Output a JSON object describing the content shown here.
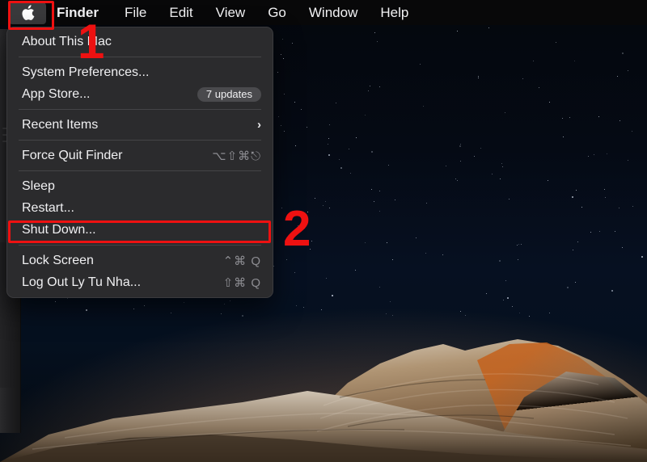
{
  "menubar": {
    "apple_icon": "apple-logo-icon",
    "items": [
      {
        "label": "Finder",
        "bold": true
      },
      {
        "label": "File",
        "bold": false
      },
      {
        "label": "Edit",
        "bold": false
      },
      {
        "label": "View",
        "bold": false
      },
      {
        "label": "Go",
        "bold": false
      },
      {
        "label": "Window",
        "bold": false
      },
      {
        "label": "Help",
        "bold": false
      }
    ]
  },
  "apple_menu": {
    "items": [
      {
        "label": "About This Mac",
        "shortcut": "",
        "badge": "",
        "chevron": "",
        "sep_after": true
      },
      {
        "label": "System Preferences...",
        "shortcut": "",
        "badge": "",
        "chevron": "",
        "sep_after": false
      },
      {
        "label": "App Store...",
        "shortcut": "",
        "badge": "7 updates",
        "chevron": "",
        "sep_after": true
      },
      {
        "label": "Recent Items",
        "shortcut": "",
        "badge": "",
        "chevron": "›",
        "sep_after": true
      },
      {
        "label": "Force Quit Finder",
        "shortcut": "⌥⇧⌘⎋",
        "badge": "",
        "chevron": "",
        "sep_after": true
      },
      {
        "label": "Sleep",
        "shortcut": "",
        "badge": "",
        "chevron": "",
        "sep_after": false
      },
      {
        "label": "Restart...",
        "shortcut": "",
        "badge": "",
        "chevron": "",
        "sep_after": false
      },
      {
        "label": "Shut Down...",
        "shortcut": "",
        "badge": "",
        "chevron": "",
        "sep_after": true
      },
      {
        "label": "Lock Screen",
        "shortcut": "⌃⌘ Q",
        "badge": "",
        "chevron": "",
        "sep_after": false
      },
      {
        "label": "Log Out Ly Tu Nha...",
        "shortcut": "⇧⌘ Q",
        "badge": "",
        "chevron": "",
        "sep_after": false
      }
    ]
  },
  "annotations": {
    "color": "#ee1111",
    "step_one": "1",
    "step_two": "2",
    "box_apple_label": "apple-menu-button-highlight",
    "box_restart_label": "restart-menu-item-highlight"
  },
  "desktop": {
    "wallpaper_name": "big-sur-night-wallpaper",
    "sky_color": "#05101f",
    "rock_color": "#9b8672"
  }
}
